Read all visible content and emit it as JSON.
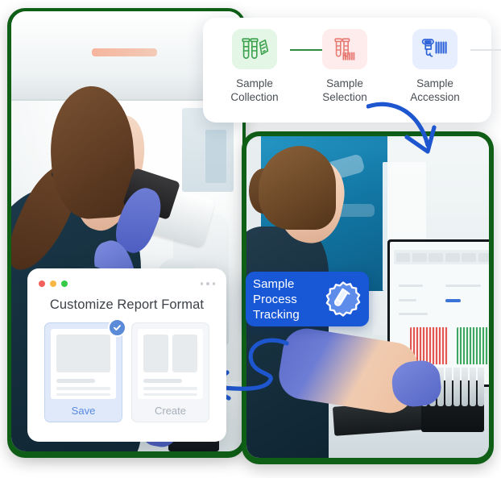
{
  "theme": {
    "frame_green": "#0f5f17",
    "accent_blue": "#1857d6",
    "arrow_blue": "#1e56cf",
    "step_green": "#2e8b3f",
    "step_red": "#e6706a",
    "step_blue": "#2f63d8",
    "save_blue": "#5a8ae0",
    "muted_gray": "#a8b0b9"
  },
  "steps_card": {
    "steps": [
      {
        "label_line1": "Sample",
        "label_line2": "Collection",
        "icon": "test-tubes-clipboard-icon",
        "state": "done",
        "tone": "green"
      },
      {
        "label_line1": "Sample",
        "label_line2": "Selection",
        "icon": "test-tubes-barcode-icon",
        "state": "current",
        "tone": "red"
      },
      {
        "label_line1": "Sample",
        "label_line2": "Accession",
        "icon": "barcode-scanner-icon",
        "state": "todo",
        "tone": "blue"
      }
    ],
    "connectors": [
      {
        "state": "done"
      },
      {
        "state": "todo"
      }
    ]
  },
  "tracking_badge": {
    "line1": "Sample",
    "line2": "Process",
    "line3": "Tracking",
    "icon": "gear-test-tube-icon"
  },
  "report_dialog": {
    "title": "Customize Report Format",
    "window_lights": [
      {
        "name": "close",
        "color": "#f4605a"
      },
      {
        "name": "minimize",
        "color": "#f7b843"
      },
      {
        "name": "maximize",
        "color": "#36c94a"
      }
    ],
    "overflow_dots": 3,
    "cards": [
      {
        "name": "single-column-template",
        "action_label": "Save",
        "selected": true,
        "layout": "single-column",
        "block_count": 1
      },
      {
        "name": "two-column-template",
        "action_label": "Create",
        "selected": false,
        "layout": "two-column",
        "block_count": 2
      }
    ],
    "selected_badge_icon": "check-circle-icon"
  },
  "photos": [
    {
      "name": "lab-technician-microscope-photo",
      "alt": "Lab technician looking into a microscope with blood sample tubes on the bench"
    },
    {
      "name": "lab-technician-computer-photo",
      "alt": "Lab technician working at a computer workstation beside an analyzer and sample rack"
    }
  ],
  "arrows": [
    {
      "name": "arrow-steps-to-photo",
      "direction": "down-right"
    },
    {
      "name": "arrow-photo-to-dialog",
      "direction": "left-loop"
    }
  ]
}
